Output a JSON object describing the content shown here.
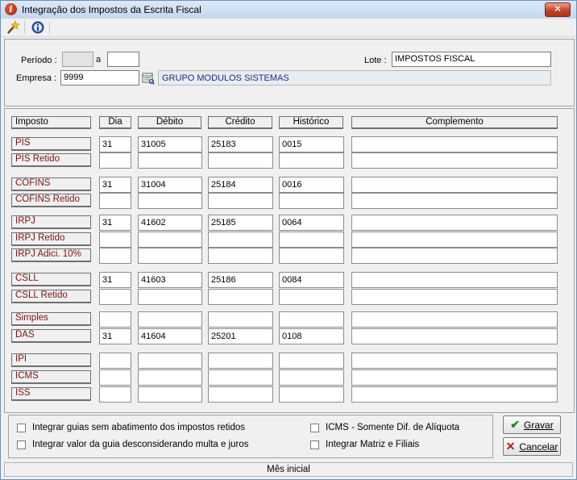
{
  "window": {
    "title": "Integração dos Impostos da Escrita Fiscal",
    "close_glyph": "✕",
    "icon": "info-icon"
  },
  "toolbar": {
    "items": [
      {
        "icon": "execute-wand-icon"
      },
      {
        "icon": "help-info-icon"
      }
    ]
  },
  "header": {
    "periodo_label": "Período :",
    "periodo_from": "",
    "a_label": "a",
    "periodo_to": "",
    "lote_label": "Lote :",
    "lote_value": "IMPOSTOS FISCAL",
    "empresa_label": "Empresa :",
    "empresa_value": "9999",
    "empresa_name": "GRUPO MODULOS SISTEMAS"
  },
  "grid": {
    "columns": [
      "Imposto",
      "Dia",
      "Débito",
      "Crédito",
      "Histórico",
      "Complemento"
    ],
    "rows": [
      {
        "label": "PIS",
        "dia": "31",
        "debito": "31005",
        "credito": "25183",
        "historico": "0015",
        "complemento": ""
      },
      {
        "label": "PIS Retido",
        "dia": "",
        "debito": "",
        "credito": "",
        "historico": "",
        "complemento": ""
      },
      {
        "label": "COFINS",
        "dia": "31",
        "debito": "31004",
        "credito": "25184",
        "historico": "0016",
        "complemento": ""
      },
      {
        "label": "COFINS Retido",
        "dia": "",
        "debito": "",
        "credito": "",
        "historico": "",
        "complemento": ""
      },
      {
        "label": "IRPJ",
        "dia": "31",
        "debito": "41602",
        "credito": "25185",
        "historico": "0064",
        "complemento": ""
      },
      {
        "label": "IRPJ Retido",
        "dia": "",
        "debito": "",
        "credito": "",
        "historico": "",
        "complemento": ""
      },
      {
        "label": "IRPJ Adici. 10%",
        "dia": "",
        "debito": "",
        "credito": "",
        "historico": "",
        "complemento": ""
      },
      {
        "label": "CSLL",
        "dia": "31",
        "debito": "41603",
        "credito": "25186",
        "historico": "0084",
        "complemento": ""
      },
      {
        "label": "CSLL Retido",
        "dia": "",
        "debito": "",
        "credito": "",
        "historico": "",
        "complemento": ""
      },
      {
        "label": "Simples",
        "dia": "",
        "debito": "",
        "credito": "",
        "historico": "",
        "complemento": ""
      },
      {
        "label": "DAS",
        "dia": "31",
        "debito": "41604",
        "credito": "25201",
        "historico": "0108",
        "complemento": ""
      },
      {
        "label": "IPI",
        "dia": "",
        "debito": "",
        "credito": "",
        "historico": "",
        "complemento": ""
      },
      {
        "label": "ICMS",
        "dia": "",
        "debito": "",
        "credito": "",
        "historico": "",
        "complemento": ""
      },
      {
        "label": "ISS",
        "dia": "",
        "debito": "",
        "credito": "",
        "historico": "",
        "complemento": ""
      }
    ]
  },
  "options": {
    "opt1": "Integrar guias sem abatimento dos impostos retidos",
    "opt2": "Integrar valor da guia desconsiderando multa e juros",
    "opt3": "ICMS - Somente Dif. de Alíquota",
    "opt4": "Integrar Matriz e Filiais"
  },
  "buttons": {
    "gravar": "Gravar",
    "cancelar": "Cancelar"
  },
  "status_bar": {
    "text": "Mês inicial"
  },
  "colors": {
    "row_label_text": "#7a1414",
    "company_name_text": "#1c2c7c",
    "gravar_icon": "#1a8a1a",
    "cancelar_icon": "#c01818"
  }
}
